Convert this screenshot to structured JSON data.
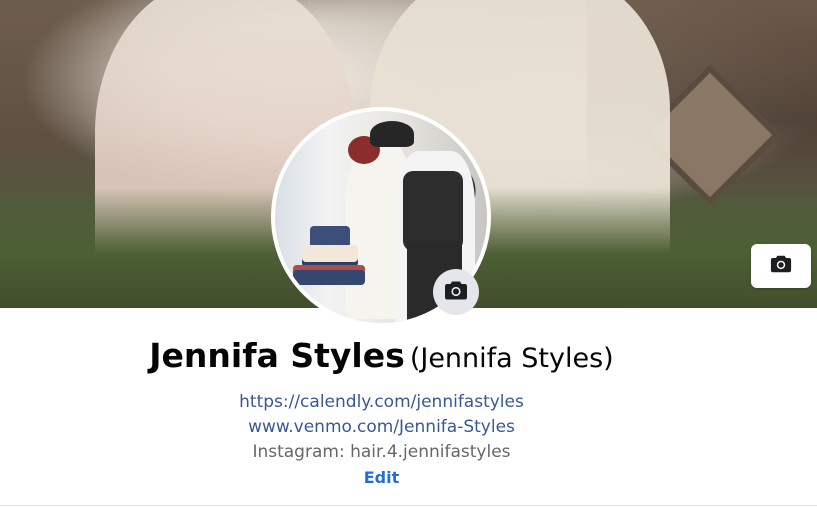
{
  "profile": {
    "name": "Jennifa Styles",
    "alternate_name": "(Jennifa Styles)",
    "links": [
      "https://calendly.com/jennifastyles",
      "www.venmo.com/Jennifa-Styles"
    ],
    "instagram": "Instagram: hair.4.jennifastyles",
    "edit_label": "Edit"
  },
  "icons": {
    "cover_camera": "camera-icon",
    "avatar_camera": "camera-icon"
  },
  "colors": {
    "link": "#385898",
    "edit": "#216fdb",
    "muted_text": "#65676b",
    "name_text": "#050505",
    "camera_button_bg": "#e4e6eb"
  }
}
